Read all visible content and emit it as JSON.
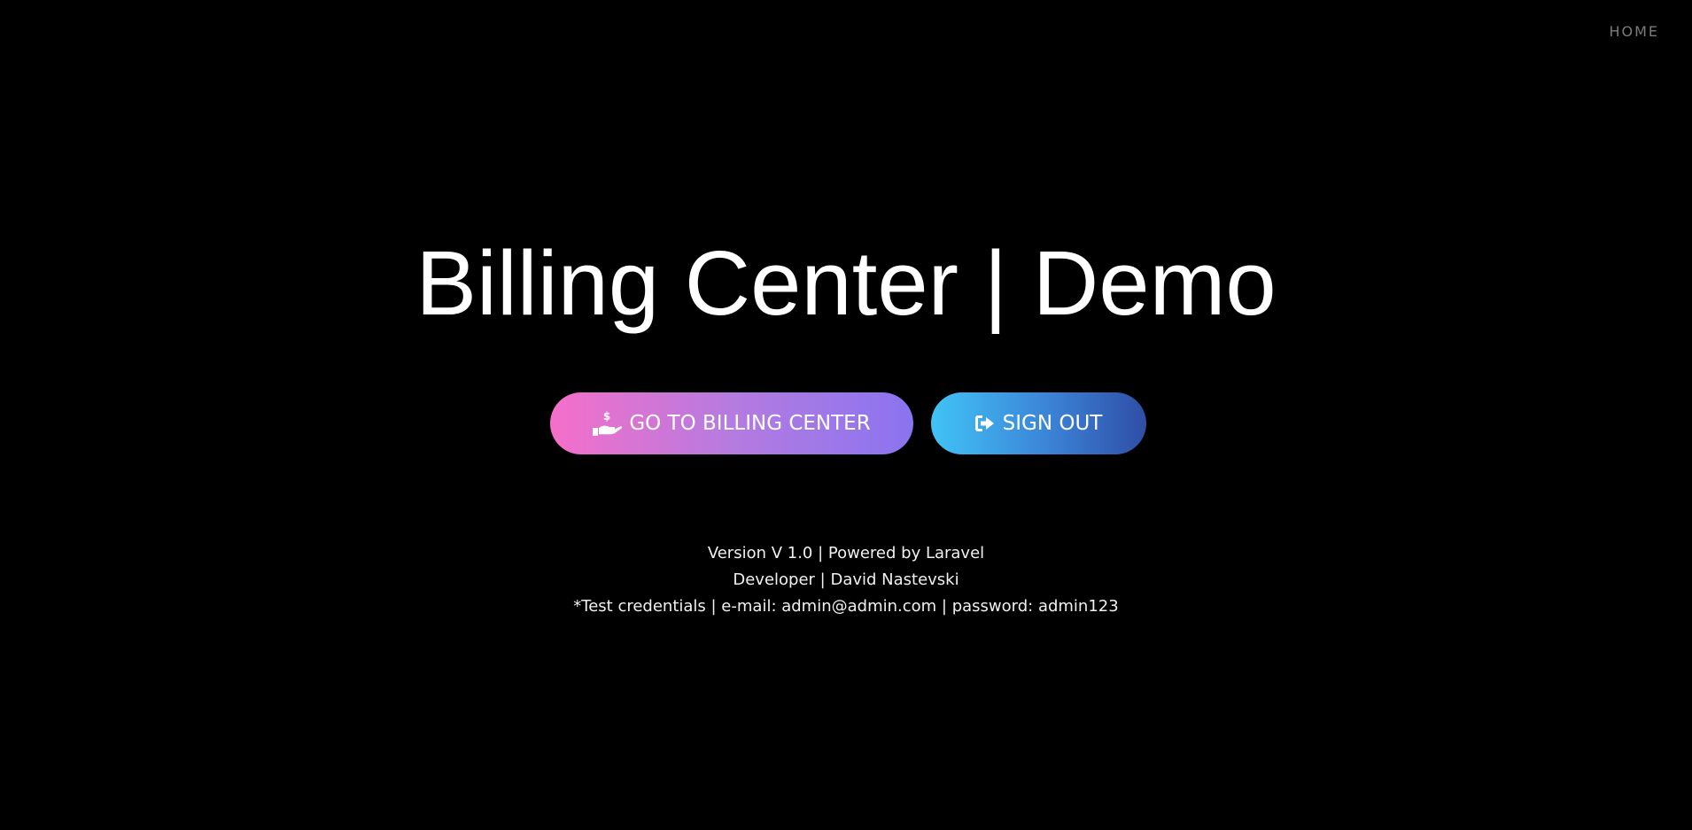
{
  "nav": {
    "home_label": "HOME"
  },
  "hero": {
    "title": "Billing Center | Demo"
  },
  "actions": {
    "billing_label": "GO TO BILLING CENTER",
    "billing_icon": "hand-holding-usd-icon",
    "signout_label": "SIGN OUT",
    "signout_icon": "sign-out-icon"
  },
  "footer": {
    "version_line": "Version V 1.0 | Powered by Laravel",
    "developer_line": "Developer | David Nastevski",
    "credentials_line": "*Test credentials | e-mail: admin@admin.com | password: admin123"
  },
  "colors": {
    "background": "#000000",
    "billing_gradient_start": "#f56fc9",
    "billing_gradient_end": "#8a74f0",
    "signout_gradient_start": "#41c3f6",
    "signout_gradient_end": "#2f4ea6"
  }
}
